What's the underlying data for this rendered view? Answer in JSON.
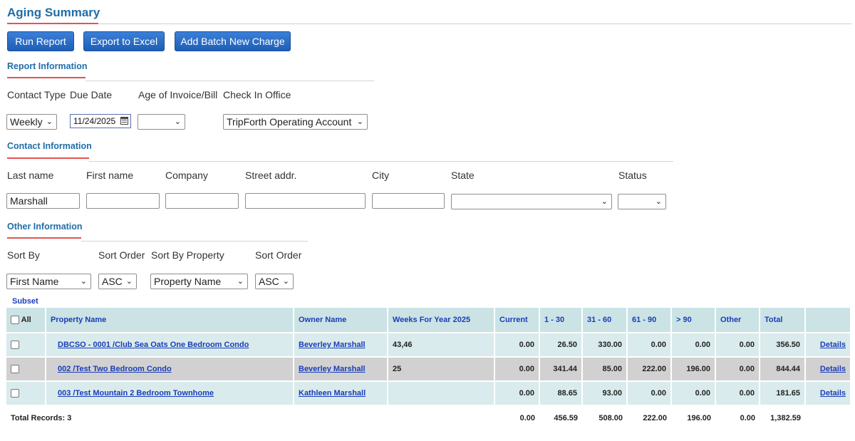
{
  "page": {
    "title": "Aging Summary"
  },
  "toolbar": {
    "run_report": "Run Report",
    "export_excel": "Export to Excel",
    "add_batch": "Add Batch New Charge"
  },
  "report_info": {
    "section_title": "Report Information",
    "contact_type": {
      "label": "Contact Type",
      "value": "Weekly"
    },
    "due_date": {
      "label": "Due Date",
      "value": "11/24/2025"
    },
    "age": {
      "label": "Age of Invoice/Bill",
      "value": ""
    },
    "office": {
      "label": "Check In Office",
      "value": "TripForth Operating Account"
    }
  },
  "contact_info": {
    "section_title": "Contact Information",
    "last_name": {
      "label": "Last name",
      "value": "Marshall"
    },
    "first_name": {
      "label": "First name",
      "value": ""
    },
    "company": {
      "label": "Company",
      "value": ""
    },
    "street": {
      "label": "Street addr.",
      "value": ""
    },
    "city": {
      "label": "City",
      "value": ""
    },
    "state": {
      "label": "State",
      "value": ""
    },
    "status": {
      "label": "Status",
      "value": ""
    }
  },
  "other_info": {
    "section_title": "Other Information",
    "sort_by": {
      "label": "Sort By",
      "value": "First Name"
    },
    "sort_order": {
      "label": "Sort Order",
      "value": "ASC"
    },
    "sort_by_property": {
      "label": "Sort By Property",
      "value": "Property Name"
    },
    "sort_order_2": {
      "label": "Sort Order",
      "value": "ASC"
    }
  },
  "subset": {
    "label": "Subset"
  },
  "table": {
    "columns": {
      "all": "All",
      "property": "Property Name",
      "owner": "Owner Name",
      "weeks": "Weeks For Year 2025",
      "current": "Current",
      "d1_30": "1 - 30",
      "d31_60": "31 - 60",
      "d61_90": "61 - 90",
      "d90": "> 90",
      "other": "Other",
      "total": "Total"
    },
    "rows": [
      {
        "property": "DBCSO - 0001 /Club Sea Oats One Bedroom Condo",
        "owner": "Beverley Marshall",
        "weeks": "43,46",
        "current": "0.00",
        "d1_30": "26.50",
        "d31_60": "330.00",
        "d61_90": "0.00",
        "d90": "0.00",
        "other": "0.00",
        "total": "356.50",
        "details": "Details"
      },
      {
        "property": "002 /Test Two Bedroom Condo",
        "owner": "Beverley Marshall",
        "weeks": "25",
        "current": "0.00",
        "d1_30": "341.44",
        "d31_60": "85.00",
        "d61_90": "222.00",
        "d90": "196.00",
        "other": "0.00",
        "total": "844.44",
        "details": "Details"
      },
      {
        "property": "003 /Test Mountain 2 Bedroom Townhome",
        "owner": "Kathleen Marshall",
        "weeks": "",
        "current": "0.00",
        "d1_30": "88.65",
        "d31_60": "93.00",
        "d61_90": "0.00",
        "d90": "0.00",
        "other": "0.00",
        "total": "181.65",
        "details": "Details"
      }
    ],
    "totals": {
      "label": "Total Records: 3",
      "current": "0.00",
      "d1_30": "456.59",
      "d31_60": "508.00",
      "d61_90": "222.00",
      "d90": "196.00",
      "other": "0.00",
      "total": "1,382.59"
    }
  }
}
